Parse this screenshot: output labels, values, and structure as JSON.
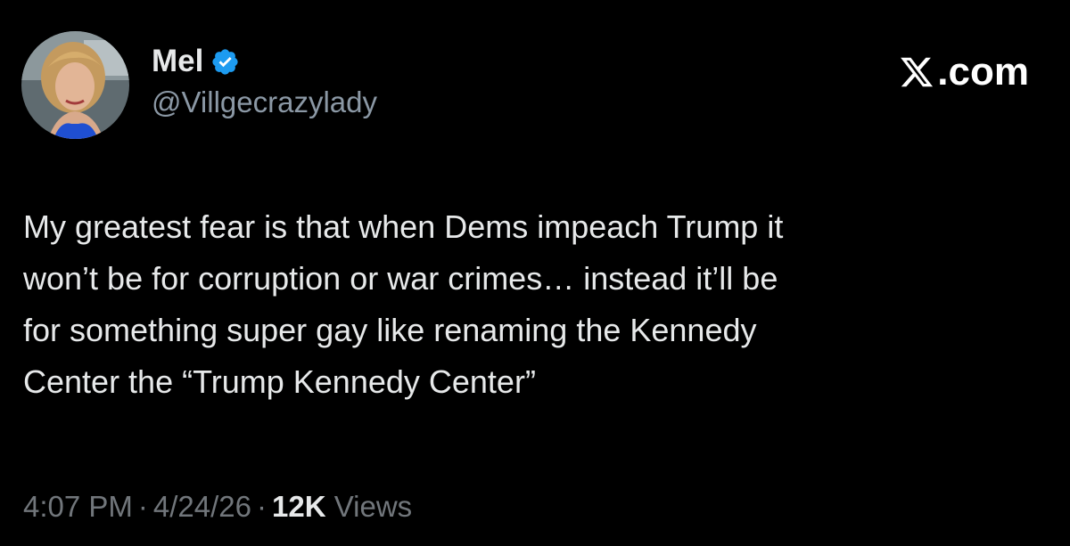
{
  "author": {
    "display_name": "Mel",
    "handle": "@Villgecrazylady",
    "verified": true,
    "verified_icon": "verified-badge-icon"
  },
  "brand": {
    "text": "com",
    "logo_icon": "x-logo-icon",
    "separator": "."
  },
  "tweet": {
    "lines": [
      "My greatest fear is that when Dems impeach Trump it",
      "won’t be for corruption or war crimes… instead it’ll be",
      "for something super gay like renaming the Kennedy",
      "Center the “Trump Kennedy Center”"
    ]
  },
  "meta": {
    "time": "4:07 PM",
    "date": "4/24/26",
    "separator": "·",
    "views_count": "12K",
    "views_label": "Views"
  },
  "colors": {
    "background": "#000000",
    "text_primary": "#e7e9ea",
    "text_secondary": "#71767b",
    "verified_blue": "#1d9bf0"
  }
}
